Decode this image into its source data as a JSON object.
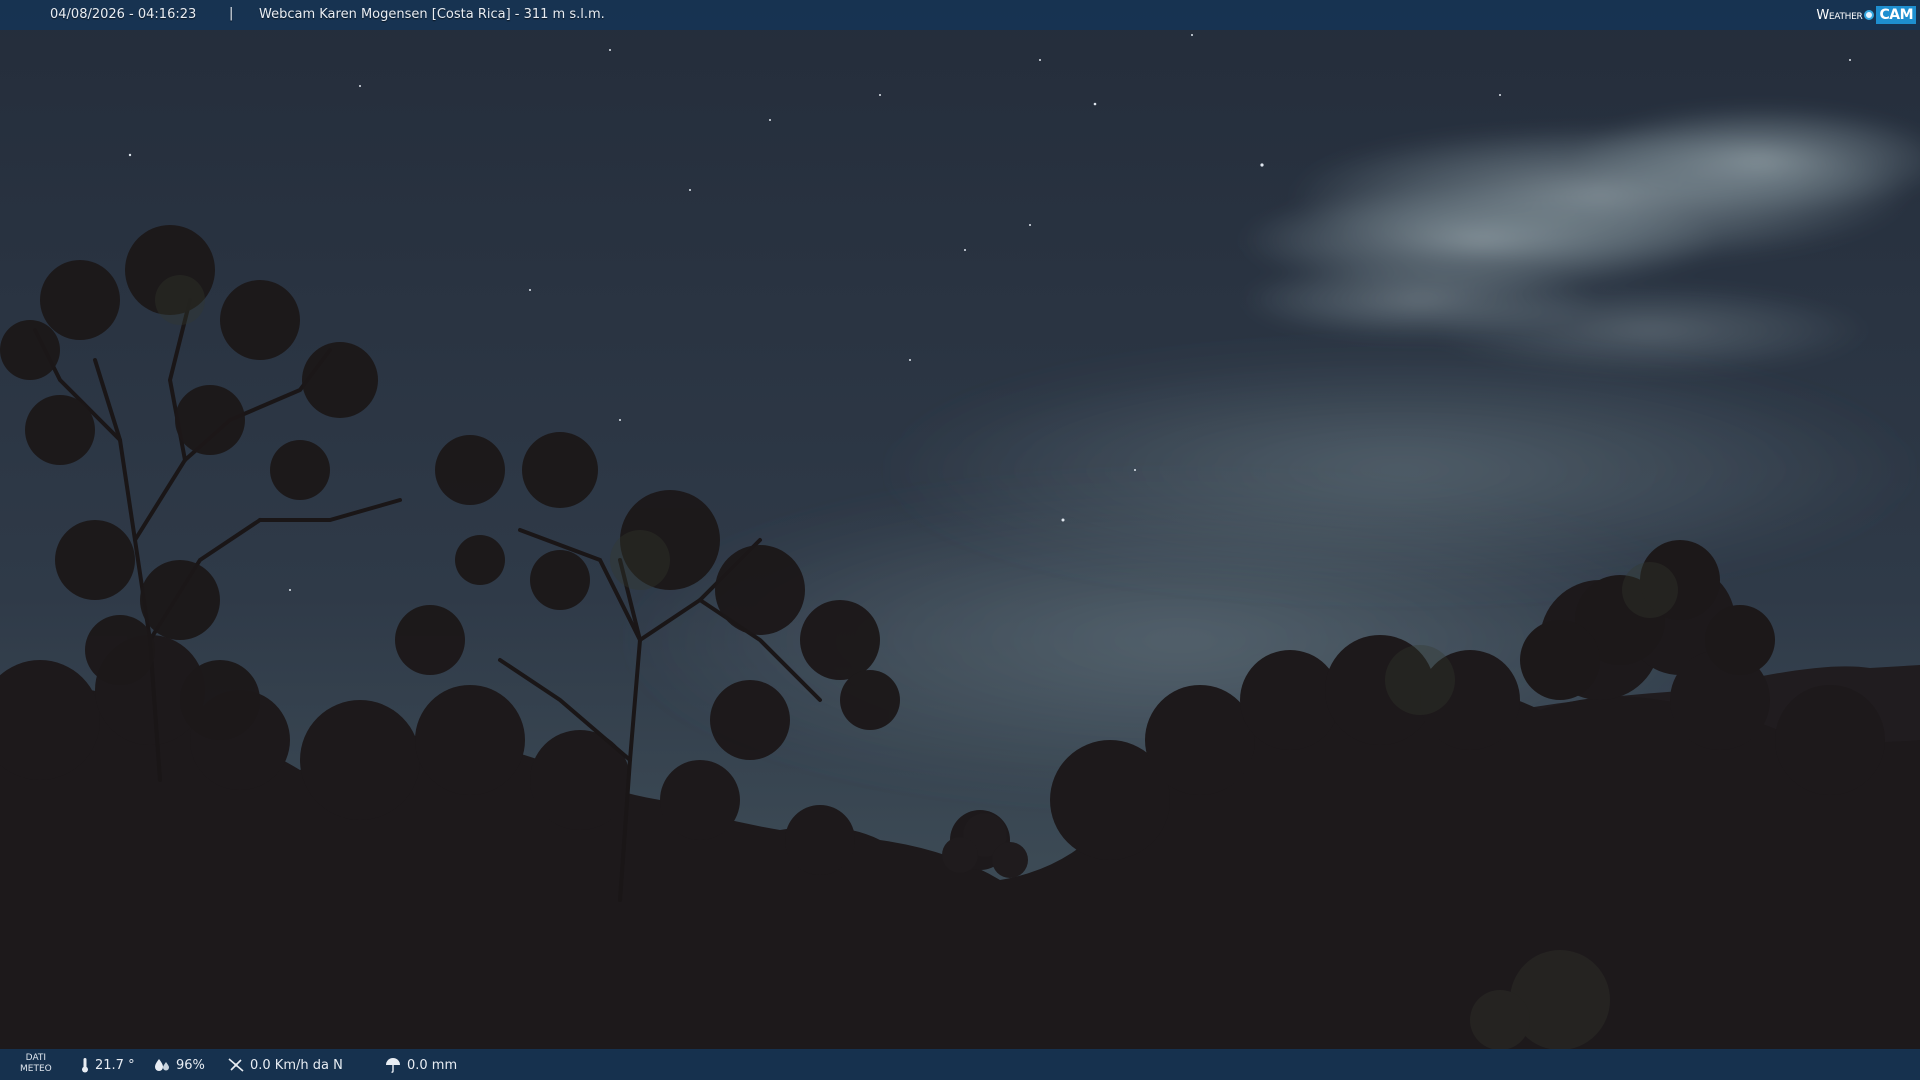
{
  "header": {
    "timestamp": "04/08/2026 - 04:16:23",
    "separator": "|",
    "camera_title": "Webcam Karen Mogensen [Costa Rica]  - 311 m s.l.m.",
    "logo_left": "Weather",
    "logo_right": "CAM"
  },
  "footer": {
    "dati_label_1": "DATI",
    "dati_label_2": "METEO",
    "temperature": "21.7 °",
    "humidity": "96%",
    "wind": "0.0 Km/h da N",
    "rain": "0.0 mm"
  },
  "icons": {
    "temperature": "thermometer-icon",
    "humidity": "humidity-drops-icon",
    "wind": "wind-vane-icon",
    "rain": "rain-umbrella-icon"
  },
  "colors": {
    "bar_background": "#163454",
    "sky": "#2a3443",
    "foliage": "#1a1718",
    "logo_accent": "#1e8fd0"
  }
}
